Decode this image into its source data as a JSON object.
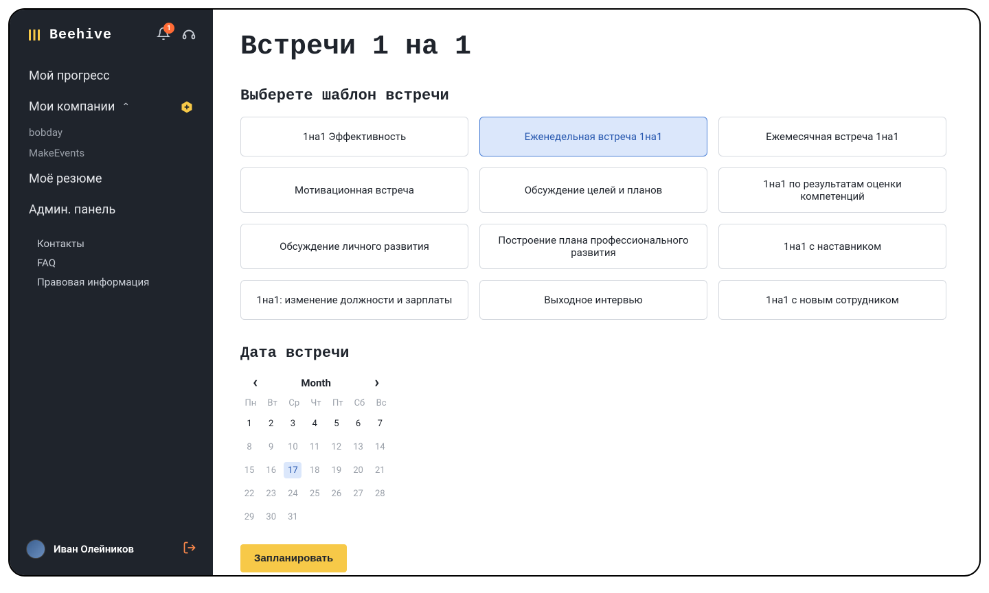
{
  "brand": {
    "name": "Beehive"
  },
  "notifications": {
    "count": "1"
  },
  "sidebar": {
    "items": [
      {
        "label": "Мой прогресс"
      },
      {
        "label": "Мои компании"
      },
      {
        "label": "Моё резюме"
      },
      {
        "label": "Админ. панель"
      }
    ],
    "companies": [
      {
        "label": "bobday"
      },
      {
        "label": "MakeEvents"
      }
    ],
    "footer": [
      {
        "label": "Контакты"
      },
      {
        "label": "FAQ"
      },
      {
        "label": "Правовая информация"
      }
    ]
  },
  "user": {
    "name": "Иван Олейников"
  },
  "page": {
    "title": "Встречи 1 на 1",
    "template_section": "Выберете шаблон встречи",
    "templates": [
      "1на1 Эффективность",
      "Еженедельная встреча 1на1",
      "Ежемесячная встреча 1на1",
      "Мотивационная встреча",
      "Обсуждение целей и планов",
      "1на1 по результатам оценки компетенций",
      "Обсуждение личного развития",
      "Построение плана профессионального развития",
      "1на1 с наставником",
      "1на1: изменение должности и зарплаты",
      "Выходное интервью",
      "1на1 с новым сотрудником"
    ],
    "selected_template_index": 1,
    "date_section": "Дата встречи",
    "schedule_button": "Запланировать"
  },
  "calendar": {
    "month_label": "Month",
    "dow": [
      "Пн",
      "Вт",
      "Ср",
      "Чт",
      "Пт",
      "Сб",
      "Вс"
    ],
    "today": 17,
    "weeks": [
      [
        1,
        2,
        3,
        4,
        5,
        6,
        7
      ],
      [
        8,
        9,
        10,
        11,
        12,
        13,
        14
      ],
      [
        15,
        16,
        17,
        18,
        19,
        20,
        21
      ],
      [
        22,
        23,
        24,
        25,
        26,
        27,
        28
      ],
      [
        29,
        30,
        31
      ]
    ]
  }
}
